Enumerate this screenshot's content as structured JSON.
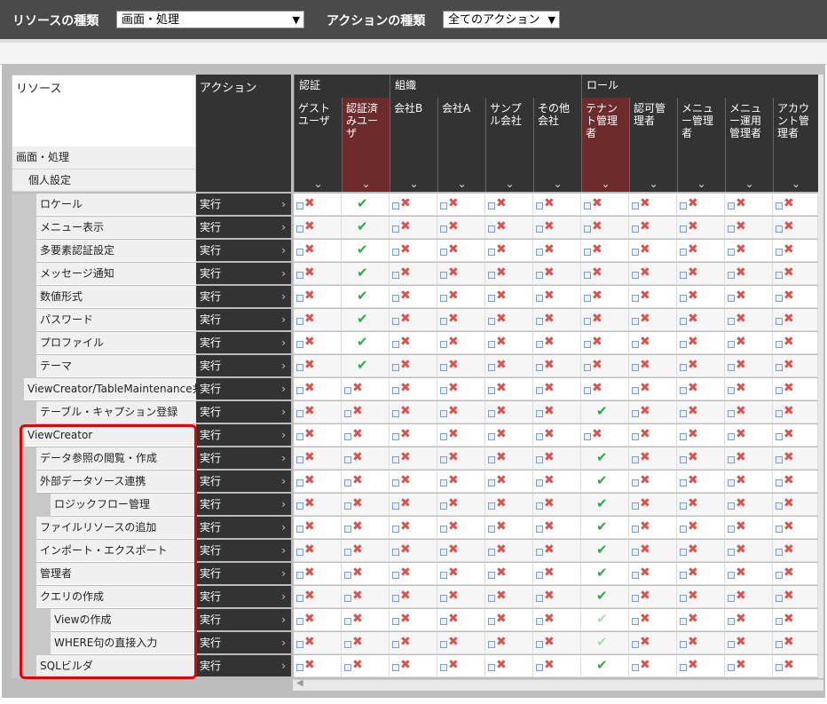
{
  "toolbar": {
    "resource_type_label": "リソースの種類",
    "resource_type_value": "画面・処理",
    "action_type_label": "アクションの種類",
    "action_type_value": "全てのアクション"
  },
  "table": {
    "resource_header": "リソース",
    "resource_path": [
      "画面・処理",
      "個人設定"
    ],
    "action_header": "アクション",
    "groups": [
      {
        "label": "認証"
      },
      {
        "label": "組織"
      },
      {
        "label": "ロール"
      }
    ],
    "columns": [
      {
        "label": "ゲストユーザ"
      },
      {
        "label": "認証済みユーザ"
      },
      {
        "label": "会社B"
      },
      {
        "label": "会社A"
      },
      {
        "label": "サンプル会社"
      },
      {
        "label": "その他会社"
      },
      {
        "label": "テナント管理者"
      },
      {
        "label": "認可管理者"
      },
      {
        "label": "メニュー管理者"
      },
      {
        "label": "メニュー運用管理者"
      },
      {
        "label": "アカウント管理者"
      }
    ],
    "action_label": "実行",
    "rows": [
      {
        "label": "ロケール",
        "perm": [
          "x",
          "ok",
          "x",
          "x",
          "x",
          "x",
          "x",
          "x",
          "x",
          "x",
          "x"
        ]
      },
      {
        "label": "メニュー表示",
        "perm": [
          "x",
          "ok",
          "x",
          "x",
          "x",
          "x",
          "x",
          "x",
          "x",
          "x",
          "x"
        ]
      },
      {
        "label": "多要素認証設定",
        "perm": [
          "x",
          "ok",
          "x",
          "x",
          "x",
          "x",
          "x",
          "x",
          "x",
          "x",
          "x"
        ]
      },
      {
        "label": "メッセージ通知",
        "perm": [
          "x",
          "ok",
          "x",
          "x",
          "x",
          "x",
          "x",
          "x",
          "x",
          "x",
          "x"
        ]
      },
      {
        "label": "数値形式",
        "perm": [
          "x",
          "ok",
          "x",
          "x",
          "x",
          "x",
          "x",
          "x",
          "x",
          "x",
          "x"
        ]
      },
      {
        "label": "パスワード",
        "perm": [
          "x",
          "ok",
          "x",
          "x",
          "x",
          "x",
          "x",
          "x",
          "x",
          "x",
          "x"
        ]
      },
      {
        "label": "プロファイル",
        "perm": [
          "x",
          "ok",
          "x",
          "x",
          "x",
          "x",
          "x",
          "x",
          "x",
          "x",
          "x"
        ]
      },
      {
        "label": "テーマ",
        "perm": [
          "x",
          "ok",
          "x",
          "x",
          "x",
          "x",
          "x",
          "x",
          "x",
          "x",
          "x"
        ]
      },
      {
        "label": "ViewCreator/TableMaintenance共通",
        "perm": [
          "x",
          "x",
          "x",
          "x",
          "x",
          "x",
          "x",
          "x",
          "x",
          "x",
          "x"
        ]
      },
      {
        "label": "テーブル・キャプション登録",
        "perm": [
          "x",
          "x",
          "x",
          "x",
          "x",
          "x",
          "ok",
          "x",
          "x",
          "x",
          "x"
        ]
      },
      {
        "label": "ViewCreator",
        "perm": [
          "x",
          "x",
          "x",
          "x",
          "x",
          "x",
          "x",
          "x",
          "x",
          "x",
          "x"
        ]
      },
      {
        "label": "データ参照の閲覧・作成",
        "perm": [
          "x",
          "x",
          "x",
          "x",
          "x",
          "x",
          "ok",
          "x",
          "x",
          "x",
          "x"
        ]
      },
      {
        "label": "外部データソース連携",
        "perm": [
          "x",
          "x",
          "x",
          "x",
          "x",
          "x",
          "ok",
          "x",
          "x",
          "x",
          "x"
        ]
      },
      {
        "label": "ロジックフロー管理",
        "perm": [
          "x",
          "x",
          "x",
          "x",
          "x",
          "x",
          "ok",
          "x",
          "x",
          "x",
          "x"
        ]
      },
      {
        "label": "ファイルリソースの追加",
        "perm": [
          "x",
          "x",
          "x",
          "x",
          "x",
          "x",
          "ok",
          "x",
          "x",
          "x",
          "x"
        ]
      },
      {
        "label": "インポート・エクスポート",
        "perm": [
          "x",
          "x",
          "x",
          "x",
          "x",
          "x",
          "ok",
          "x",
          "x",
          "x",
          "x"
        ]
      },
      {
        "label": "管理者",
        "perm": [
          "x",
          "x",
          "x",
          "x",
          "x",
          "x",
          "ok",
          "x",
          "x",
          "x",
          "x"
        ]
      },
      {
        "label": "クエリの作成",
        "perm": [
          "x",
          "x",
          "x",
          "x",
          "x",
          "x",
          "ok",
          "x",
          "x",
          "x",
          "x"
        ]
      },
      {
        "label": "Viewの作成",
        "perm": [
          "x",
          "x",
          "x",
          "x",
          "x",
          "x",
          "ok-light",
          "x",
          "x",
          "x",
          "x"
        ]
      },
      {
        "label": "WHERE句の直接入力",
        "perm": [
          "x",
          "x",
          "x",
          "x",
          "x",
          "x",
          "ok-light",
          "x",
          "x",
          "x",
          "x"
        ]
      },
      {
        "label": "SQLビルダ",
        "perm": [
          "x",
          "x",
          "x",
          "x",
          "x",
          "x",
          "ok",
          "x",
          "x",
          "x",
          "x"
        ]
      }
    ]
  },
  "colors": {
    "accent": "#6e2b2b",
    "header_bg": "#333333",
    "check": "#2ea84a",
    "cross": "#d9534f",
    "highlight_box": "#e60000"
  }
}
